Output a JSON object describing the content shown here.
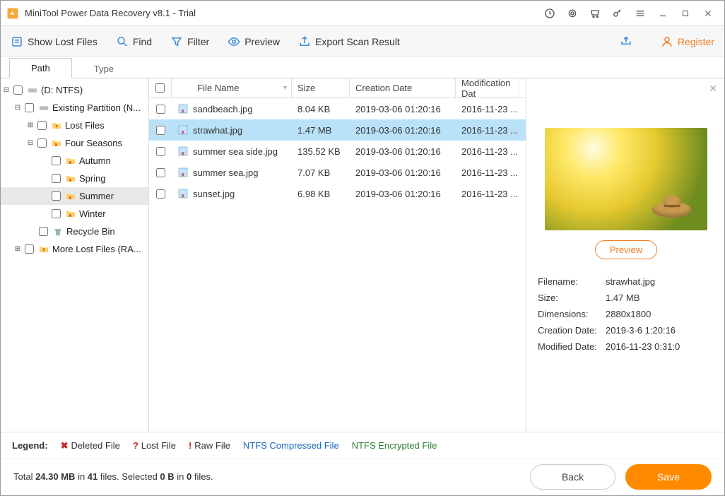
{
  "window": {
    "title": "MiniTool Power Data Recovery v8.1 - Trial"
  },
  "toolbar": {
    "show_lost": "Show Lost Files",
    "find": "Find",
    "filter": "Filter",
    "preview": "Preview",
    "export": "Export Scan Result",
    "register": "Register"
  },
  "tabs": {
    "path": "Path",
    "type": "Type"
  },
  "tree": {
    "root": "(D: NTFS)",
    "existing": "Existing Partition (N...",
    "lost_files": "Lost Files",
    "four_seasons": "Four Seasons",
    "autumn": "Autumn",
    "spring": "Spring",
    "summer": "Summer",
    "winter": "Winter",
    "recycle": "Recycle Bin",
    "more_lost": "More Lost Files (RA..."
  },
  "columns": {
    "name": "File Name",
    "size": "Size",
    "created": "Creation Date",
    "modified": "Modification Dat"
  },
  "files": [
    {
      "name": "sandbeach.jpg",
      "size": "8.04 KB",
      "created": "2019-03-06 01:20:16",
      "modified": "2016-11-23 ..."
    },
    {
      "name": "strawhat.jpg",
      "size": "1.47 MB",
      "created": "2019-03-06 01:20:16",
      "modified": "2016-11-23 ..."
    },
    {
      "name": "summer sea side.jpg",
      "size": "135.52 KB",
      "created": "2019-03-06 01:20:16",
      "modified": "2016-11-23 ..."
    },
    {
      "name": "summer sea.jpg",
      "size": "7.07 KB",
      "created": "2019-03-06 01:20:16",
      "modified": "2016-11-23 ..."
    },
    {
      "name": "sunset.jpg",
      "size": "6.98 KB",
      "created": "2019-03-06 01:20:16",
      "modified": "2016-11-23 ..."
    }
  ],
  "preview": {
    "button": "Preview",
    "labels": {
      "filename": "Filename:",
      "size": "Size:",
      "dimensions": "Dimensions:",
      "created": "Creation Date:",
      "modified": "Modified Date:"
    },
    "values": {
      "filename": "strawhat.jpg",
      "size": "1.47 MB",
      "dimensions": "2880x1800",
      "created": "2019-3-6 1:20:16",
      "modified": "2016-11-23 0:31:0"
    }
  },
  "legend": {
    "label": "Legend:",
    "deleted": "Deleted File",
    "lost": "Lost File",
    "raw": "Raw File",
    "ntfs_c": "NTFS Compressed File",
    "ntfs_e": "NTFS Encrypted File"
  },
  "bottom": {
    "total_pre": "Total ",
    "total_mb": "24.30 MB",
    "in": " in ",
    "files_count": "41",
    "files_suffix": " files.  Selected ",
    "sel_b": "0 B",
    "sel_in": " in ",
    "sel_files": "0",
    "sel_suffix": " files.",
    "back": "Back",
    "save": "Save"
  }
}
